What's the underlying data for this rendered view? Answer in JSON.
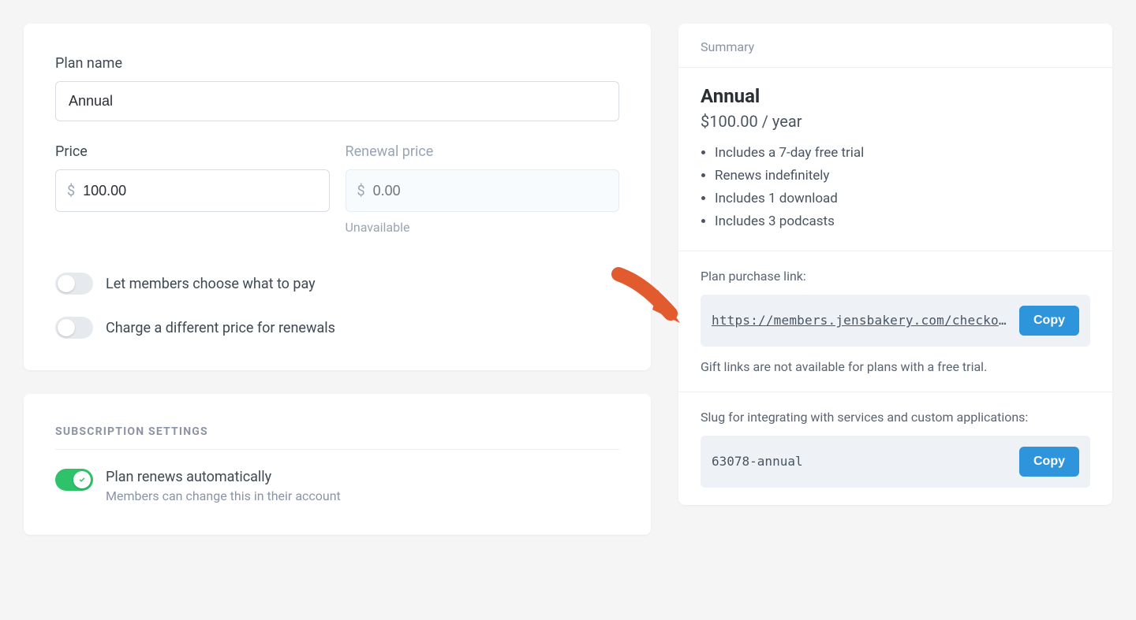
{
  "plan": {
    "name_label": "Plan name",
    "name_value": "Annual",
    "price_label": "Price",
    "price_value": "100.00",
    "currency": "$",
    "renewal_label": "Renewal price",
    "renewal_placeholder": "0.00",
    "renewal_helper": "Unavailable",
    "toggle_choose_label": "Let members choose what to pay",
    "toggle_renewal_label": "Charge a different price for renewals"
  },
  "subscription": {
    "header": "SUBSCRIPTION SETTINGS",
    "auto_title": "Plan renews automatically",
    "auto_sub": "Members can change this in their account"
  },
  "summary": {
    "header": "Summary",
    "title": "Annual",
    "price": "$100.00 / year",
    "items": [
      "Includes a 7-day free trial",
      "Renews indefinitely",
      "Includes 1 download",
      "Includes 3 podcasts"
    ],
    "purchase_label": "Plan purchase link:",
    "purchase_link": "https://members.jensbakery.com/checkout?pla",
    "copy_label": "Copy",
    "gift_note": "Gift links are not available for plans with a free trial.",
    "slug_label": "Slug for integrating with services and custom applications:",
    "slug_value": "63078-annual"
  }
}
